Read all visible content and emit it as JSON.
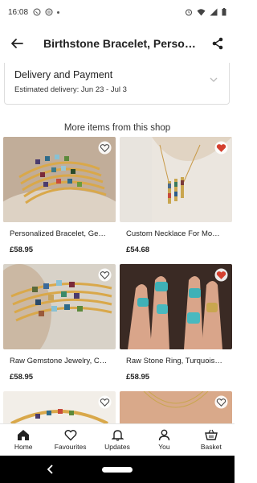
{
  "status_bar": {
    "time": "16:08"
  },
  "header": {
    "title": "Birthstone Bracelet, Personaliz…"
  },
  "delivery": {
    "title": "Delivery and Payment",
    "estimate": "Estimated delivery: Jun 23 - Jul 3"
  },
  "section_title": "More items from this shop",
  "items": [
    {
      "name": "Personalized Bracelet, Ge…",
      "price": "£58.95",
      "favourited": false
    },
    {
      "name": "Custom Necklace For Mo…",
      "price": "£54.68",
      "favourited": true
    },
    {
      "name": "Raw Gemstone Jewelry, C…",
      "price": "£58.95",
      "favourited": false
    },
    {
      "name": "Raw Stone Ring, Turquois…",
      "price": "£58.95",
      "favourited": true
    },
    {
      "name": "",
      "price": "",
      "favourited": false
    },
    {
      "name": "",
      "price": "",
      "favourited": false
    }
  ],
  "nav": {
    "home": "Home",
    "favourites": "Favourites",
    "updates": "Updates",
    "you": "You",
    "basket": "Basket"
  },
  "colors": {
    "heart_active": "#d4402f",
    "accent": "#222222"
  }
}
